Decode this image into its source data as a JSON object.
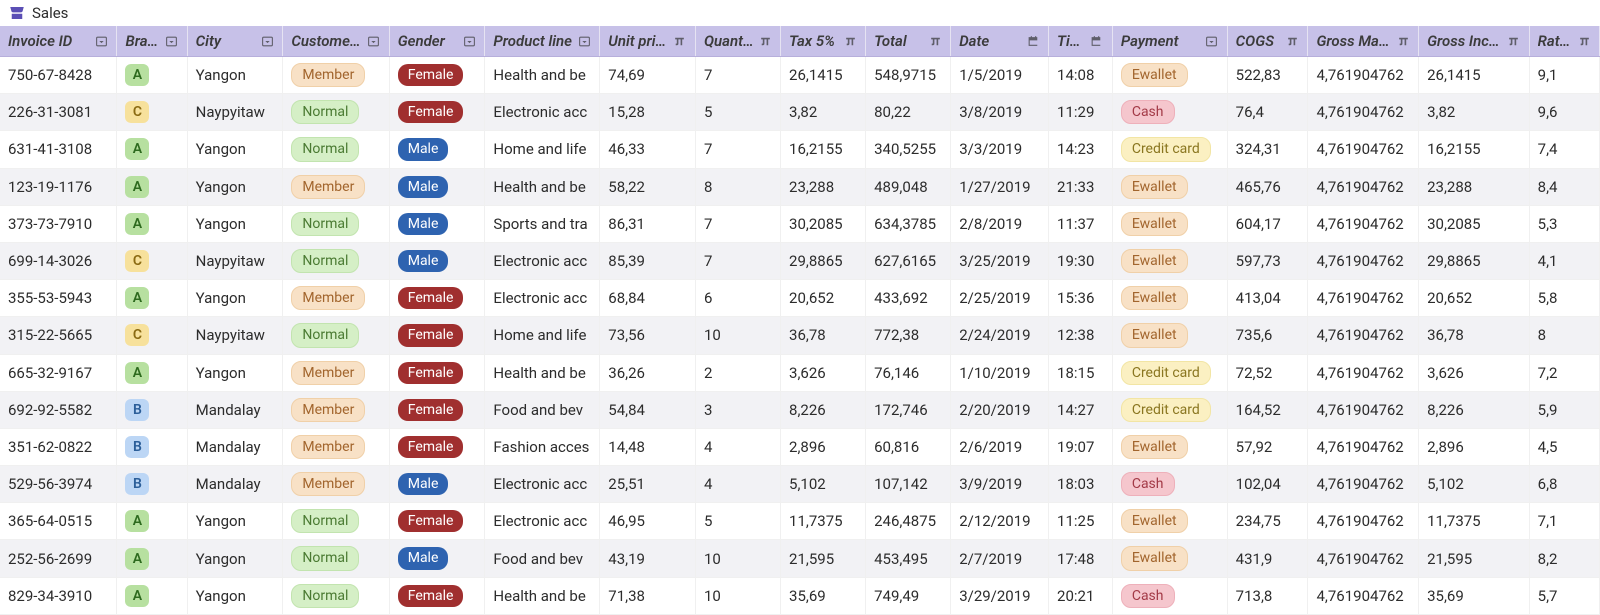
{
  "title": "Sales",
  "columns": [
    {
      "key": "invoice",
      "label": "Invoice ID",
      "icon": "enum"
    },
    {
      "key": "branch",
      "label": "Branch",
      "icon": "enum"
    },
    {
      "key": "city",
      "label": "City",
      "icon": "enum"
    },
    {
      "key": "cust",
      "label": "Customer ty",
      "icon": "enum"
    },
    {
      "key": "gender",
      "label": "Gender",
      "icon": "enum"
    },
    {
      "key": "product",
      "label": "Product line",
      "icon": "enum"
    },
    {
      "key": "uprice",
      "label": "Unit price",
      "icon": "pi"
    },
    {
      "key": "qty",
      "label": "Quantity",
      "icon": "pi"
    },
    {
      "key": "tax",
      "label": "Tax 5%",
      "icon": "pi"
    },
    {
      "key": "total",
      "label": "Total",
      "icon": "pi"
    },
    {
      "key": "date",
      "label": "Date",
      "icon": "calendar"
    },
    {
      "key": "time",
      "label": "Time",
      "icon": "calendar"
    },
    {
      "key": "payment",
      "label": "Payment",
      "icon": "enum"
    },
    {
      "key": "cogs",
      "label": "COGS",
      "icon": "pi"
    },
    {
      "key": "gmp",
      "label": "Gross Margi",
      "icon": "pi"
    },
    {
      "key": "gi",
      "label": "Gross Incom",
      "icon": "pi"
    },
    {
      "key": "rating",
      "label": "Rating",
      "icon": "pi"
    }
  ],
  "rows": [
    {
      "invoice": "750-67-8428",
      "branch": "A",
      "city": "Yangon",
      "cust": "Member",
      "gender": "Female",
      "product": "Health and be",
      "uprice": "74,69",
      "qty": "7",
      "tax": "26,1415",
      "total": "548,9715",
      "date": "1/5/2019",
      "time": "14:08",
      "payment": "Ewallet",
      "cogs": "522,83",
      "gmp": "4,761904762",
      "gi": "26,1415",
      "rating": "9,1"
    },
    {
      "invoice": "226-31-3081",
      "branch": "C",
      "city": "Naypyitaw",
      "cust": "Normal",
      "gender": "Female",
      "product": "Electronic acc",
      "uprice": "15,28",
      "qty": "5",
      "tax": "3,82",
      "total": "80,22",
      "date": "3/8/2019",
      "time": "11:29",
      "payment": "Cash",
      "cogs": "76,4",
      "gmp": "4,761904762",
      "gi": "3,82",
      "rating": "9,6"
    },
    {
      "invoice": "631-41-3108",
      "branch": "A",
      "city": "Yangon",
      "cust": "Normal",
      "gender": "Male",
      "product": "Home and life",
      "uprice": "46,33",
      "qty": "7",
      "tax": "16,2155",
      "total": "340,5255",
      "date": "3/3/2019",
      "time": "14:23",
      "payment": "Credit card",
      "cogs": "324,31",
      "gmp": "4,761904762",
      "gi": "16,2155",
      "rating": "7,4"
    },
    {
      "invoice": "123-19-1176",
      "branch": "A",
      "city": "Yangon",
      "cust": "Member",
      "gender": "Male",
      "product": "Health and be",
      "uprice": "58,22",
      "qty": "8",
      "tax": "23,288",
      "total": "489,048",
      "date": "1/27/2019",
      "time": "21:33",
      "payment": "Ewallet",
      "cogs": "465,76",
      "gmp": "4,761904762",
      "gi": "23,288",
      "rating": "8,4"
    },
    {
      "invoice": "373-73-7910",
      "branch": "A",
      "city": "Yangon",
      "cust": "Normal",
      "gender": "Male",
      "product": "Sports and tra",
      "uprice": "86,31",
      "qty": "7",
      "tax": "30,2085",
      "total": "634,3785",
      "date": "2/8/2019",
      "time": "11:37",
      "payment": "Ewallet",
      "cogs": "604,17",
      "gmp": "4,761904762",
      "gi": "30,2085",
      "rating": "5,3"
    },
    {
      "invoice": "699-14-3026",
      "branch": "C",
      "city": "Naypyitaw",
      "cust": "Normal",
      "gender": "Male",
      "product": "Electronic acc",
      "uprice": "85,39",
      "qty": "7",
      "tax": "29,8865",
      "total": "627,6165",
      "date": "3/25/2019",
      "time": "19:30",
      "payment": "Ewallet",
      "cogs": "597,73",
      "gmp": "4,761904762",
      "gi": "29,8865",
      "rating": "4,1"
    },
    {
      "invoice": "355-53-5943",
      "branch": "A",
      "city": "Yangon",
      "cust": "Member",
      "gender": "Female",
      "product": "Electronic acc",
      "uprice": "68,84",
      "qty": "6",
      "tax": "20,652",
      "total": "433,692",
      "date": "2/25/2019",
      "time": "15:36",
      "payment": "Ewallet",
      "cogs": "413,04",
      "gmp": "4,761904762",
      "gi": "20,652",
      "rating": "5,8"
    },
    {
      "invoice": "315-22-5665",
      "branch": "C",
      "city": "Naypyitaw",
      "cust": "Normal",
      "gender": "Female",
      "product": "Home and life",
      "uprice": "73,56",
      "qty": "10",
      "tax": "36,78",
      "total": "772,38",
      "date": "2/24/2019",
      "time": "12:38",
      "payment": "Ewallet",
      "cogs": "735,6",
      "gmp": "4,761904762",
      "gi": "36,78",
      "rating": "8"
    },
    {
      "invoice": "665-32-9167",
      "branch": "A",
      "city": "Yangon",
      "cust": "Member",
      "gender": "Female",
      "product": "Health and be",
      "uprice": "36,26",
      "qty": "2",
      "tax": "3,626",
      "total": "76,146",
      "date": "1/10/2019",
      "time": "18:15",
      "payment": "Credit card",
      "cogs": "72,52",
      "gmp": "4,761904762",
      "gi": "3,626",
      "rating": "7,2"
    },
    {
      "invoice": "692-92-5582",
      "branch": "B",
      "city": "Mandalay",
      "cust": "Member",
      "gender": "Female",
      "product": "Food and bev",
      "uprice": "54,84",
      "qty": "3",
      "tax": "8,226",
      "total": "172,746",
      "date": "2/20/2019",
      "time": "14:27",
      "payment": "Credit card",
      "cogs": "164,52",
      "gmp": "4,761904762",
      "gi": "8,226",
      "rating": "5,9"
    },
    {
      "invoice": "351-62-0822",
      "branch": "B",
      "city": "Mandalay",
      "cust": "Member",
      "gender": "Female",
      "product": "Fashion acces",
      "uprice": "14,48",
      "qty": "4",
      "tax": "2,896",
      "total": "60,816",
      "date": "2/6/2019",
      "time": "19:07",
      "payment": "Ewallet",
      "cogs": "57,92",
      "gmp": "4,761904762",
      "gi": "2,896",
      "rating": "4,5"
    },
    {
      "invoice": "529-56-3974",
      "branch": "B",
      "city": "Mandalay",
      "cust": "Member",
      "gender": "Male",
      "product": "Electronic acc",
      "uprice": "25,51",
      "qty": "4",
      "tax": "5,102",
      "total": "107,142",
      "date": "3/9/2019",
      "time": "18:03",
      "payment": "Cash",
      "cogs": "102,04",
      "gmp": "4,761904762",
      "gi": "5,102",
      "rating": "6,8"
    },
    {
      "invoice": "365-64-0515",
      "branch": "A",
      "city": "Yangon",
      "cust": "Normal",
      "gender": "Female",
      "product": "Electronic acc",
      "uprice": "46,95",
      "qty": "5",
      "tax": "11,7375",
      "total": "246,4875",
      "date": "2/12/2019",
      "time": "11:25",
      "payment": "Ewallet",
      "cogs": "234,75",
      "gmp": "4,761904762",
      "gi": "11,7375",
      "rating": "7,1"
    },
    {
      "invoice": "252-56-2699",
      "branch": "A",
      "city": "Yangon",
      "cust": "Normal",
      "gender": "Male",
      "product": "Food and bev",
      "uprice": "43,19",
      "qty": "10",
      "tax": "21,595",
      "total": "453,495",
      "date": "2/7/2019",
      "time": "17:48",
      "payment": "Ewallet",
      "cogs": "431,9",
      "gmp": "4,761904762",
      "gi": "21,595",
      "rating": "8,2"
    },
    {
      "invoice": "829-34-3910",
      "branch": "A",
      "city": "Yangon",
      "cust": "Normal",
      "gender": "Female",
      "product": "Health and be",
      "uprice": "71,38",
      "qty": "10",
      "tax": "35,69",
      "total": "749,49",
      "date": "3/29/2019",
      "time": "20:21",
      "payment": "Cash",
      "cogs": "713,8",
      "gmp": "4,761904762",
      "gi": "35,69",
      "rating": "5,7"
    }
  ]
}
